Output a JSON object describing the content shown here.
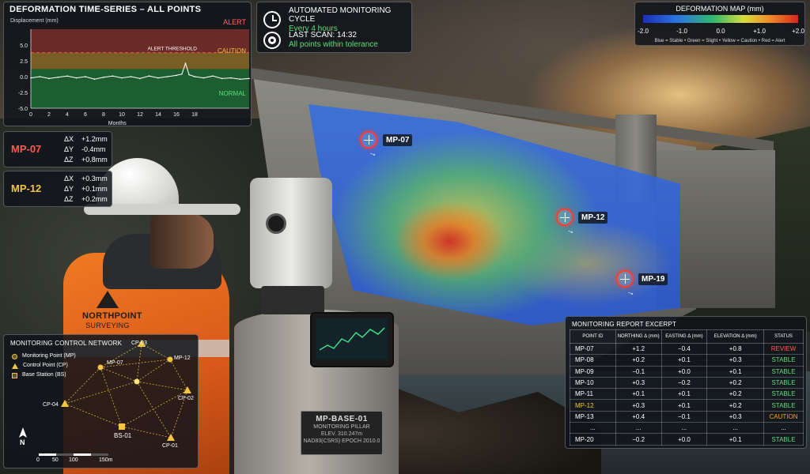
{
  "timeseries": {
    "title": "DEFORMATION TIME-SERIES – ALL POINTS",
    "ylabel": "Displacement (mm)",
    "xlabel": "Months",
    "zones": {
      "alert": "ALERT",
      "caution": "CAUTION",
      "normal": "NORMAL"
    },
    "threshold_label": "ALERT THRESHOLD",
    "y_ticks": [
      "5.0",
      "2.5",
      "0.0",
      "-2.5",
      "-5.0"
    ],
    "x_ticks": [
      "0",
      "2",
      "4",
      "6",
      "8",
      "10",
      "12",
      "14",
      "16",
      "18"
    ],
    "colors": {
      "alert": "#7a2f2a",
      "caution": "#8a6b26",
      "normal": "#1f6b35",
      "threshold": "#ff4d4d"
    }
  },
  "chart_data": {
    "type": "line",
    "title": "DEFORMATION TIME-SERIES – ALL POINTS",
    "xlabel": "Months",
    "ylabel": "Displacement (mm)",
    "xlim": [
      0,
      24
    ],
    "ylim": [
      -5,
      7.5
    ],
    "alert_threshold": 3.8,
    "series": [
      {
        "x": [
          0,
          1,
          2,
          3,
          4,
          5,
          6,
          7,
          8,
          9,
          10,
          11,
          12,
          13,
          14,
          15,
          16,
          16.6,
          17,
          17.4,
          18,
          19,
          20,
          21,
          22,
          23,
          24
        ],
        "values": [
          -0.2,
          0.0,
          -0.3,
          -0.1,
          0.1,
          -0.2,
          0.0,
          -0.4,
          -0.1,
          0.1,
          -0.2,
          0.0,
          -0.3,
          0.1,
          -0.2,
          0.0,
          0.2,
          0.4,
          2.1,
          0.3,
          0.0,
          -0.2,
          0.1,
          -0.3,
          -0.2,
          -0.4,
          -0.3
        ]
      }
    ]
  },
  "cycle": {
    "line1_head": "AUTOMATED MONITORING CYCLE",
    "line1_sub": "Every 4 hours",
    "line2_head": "LAST SCAN: 14:32",
    "line2_sub": "All points within tolerance",
    "clock_icon": "clock-icon",
    "target_icon": "target-icon"
  },
  "deformation_map": {
    "title": "DEFORMATION MAP (mm)",
    "ticks": [
      "-2.0",
      "-1.0",
      "0.0",
      "+1.0",
      "+2.0"
    ],
    "legend": "Blue = Stable  •  Green = Slight  •  Yellow = Caution  •  Red = Alert"
  },
  "deltas": [
    {
      "name": "MP-07",
      "color": "#ff5a4d",
      "dx": "+1.2mm",
      "dy": "-0.4mm",
      "dz": "+0.8mm"
    },
    {
      "name": "MP-12",
      "color": "#f5c542",
      "dx": "+0.3mm",
      "dy": "+0.1mm",
      "dz": "+0.2mm"
    }
  ],
  "delta_keys": {
    "dx": "ΔX",
    "dy": "ΔY",
    "dz": "ΔZ"
  },
  "scene_points": [
    {
      "name": "MP-07"
    },
    {
      "name": "MP-12"
    },
    {
      "name": "MP-19"
    }
  ],
  "branding": {
    "company": "NORTHPOINT",
    "sub": "SURVEYING"
  },
  "plaque": {
    "title": "MP-BASE-01",
    "line1": "MONITORING PILLAR",
    "line2": "ELEV. 310.247m",
    "line3": "NAD83(CSRS) EPOCH 2010.0"
  },
  "network": {
    "title": "MONITORING CONTROL NETWORK",
    "legend": [
      "Monitoring Point (MP)",
      "Control Point (CP)",
      "Base Station (BS)"
    ],
    "labels": {
      "cp03": "CP-03",
      "mp07": "MP-07",
      "mp12": "MP-12",
      "cp04": "CP-04",
      "cp02": "CP-02",
      "bs01": "BS-01",
      "cp01": "CP-01"
    },
    "north": "N",
    "scale": [
      "0",
      "50",
      "100",
      "150m"
    ]
  },
  "report": {
    "title": "MONITORING REPORT EXCERPT",
    "headers": [
      "POINT ID",
      "NORTHING Δ (mm)",
      "EASTING Δ (mm)",
      "ELEVATION Δ (mm)",
      "STATUS"
    ],
    "rows": [
      [
        "MP-07",
        "+1.2",
        "−0.4",
        "+0.8",
        "REVIEW"
      ],
      [
        "MP-08",
        "+0.2",
        "+0.1",
        "+0.3",
        "STABLE"
      ],
      [
        "MP-09",
        "−0.1",
        "+0.0",
        "+0.1",
        "STABLE"
      ],
      [
        "MP-10",
        "+0.3",
        "−0.2",
        "+0.2",
        "STABLE"
      ],
      [
        "MP-11",
        "+0.1",
        "+0.1",
        "+0.2",
        "STABLE"
      ],
      [
        "MP-12",
        "+0.3",
        "+0.1",
        "+0.2",
        "STABLE"
      ],
      [
        "MP-13",
        "+0.4",
        "−0.1",
        "+0.3",
        "CAUTION"
      ],
      [
        "...",
        "...",
        "...",
        "...",
        "..."
      ],
      [
        "MP-20",
        "−0.2",
        "+0.0",
        "+0.1",
        "STABLE"
      ]
    ]
  }
}
